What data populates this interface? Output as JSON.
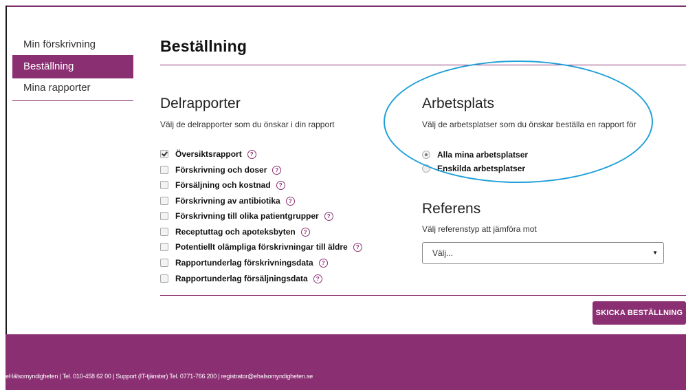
{
  "sidebar": {
    "items": [
      {
        "label": "Min förskrivning"
      },
      {
        "label": "Beställning"
      },
      {
        "label": "Mina rapporter"
      }
    ]
  },
  "page": {
    "title": "Beställning"
  },
  "delrapporter": {
    "heading": "Delrapporter",
    "subtitle": "Välj de delrapporter som du önskar i din rapport",
    "items": [
      {
        "label": "Översiktsrapport",
        "checked": true
      },
      {
        "label": "Förskrivning och doser",
        "checked": false
      },
      {
        "label": "Försäljning och kostnad",
        "checked": false
      },
      {
        "label": "Förskrivning av antibiotika",
        "checked": false
      },
      {
        "label": "Förskrivning till olika patientgrupper",
        "checked": false
      },
      {
        "label": "Receptuttag och apoteksbyten",
        "checked": false
      },
      {
        "label": "Potentiellt olämpliga förskrivningar till äldre",
        "checked": false
      },
      {
        "label": "Rapportunderlag förskrivningsdata",
        "checked": false
      },
      {
        "label": "Rapportunderlag försäljningsdata",
        "checked": false
      }
    ],
    "help_glyph": "?"
  },
  "arbetsplats": {
    "heading": "Arbetsplats",
    "subtitle": "Välj de arbetsplatser som du önskar beställa en rapport för",
    "options": [
      {
        "label": "Alla mina arbetsplatser",
        "selected": true
      },
      {
        "label": "Enskilda arbetsplatser",
        "selected": false
      }
    ]
  },
  "referens": {
    "heading": "Referens",
    "subtitle": "Välj referenstyp att jämföra mot",
    "select_value": "Välj...",
    "arrow_glyph": "▼"
  },
  "actions": {
    "send_label": "SKICKA BESTÄLLNING"
  },
  "footer": {
    "text": "eHälsomyndigheten | Tel. 010-458 62 00 | Support (IT-tjänster) Tel. 0771-766 200 | registrator@ehalsomyndigheten.se"
  },
  "colors": {
    "brand": "#8b2f73",
    "annotation": "#1fa0d8"
  }
}
